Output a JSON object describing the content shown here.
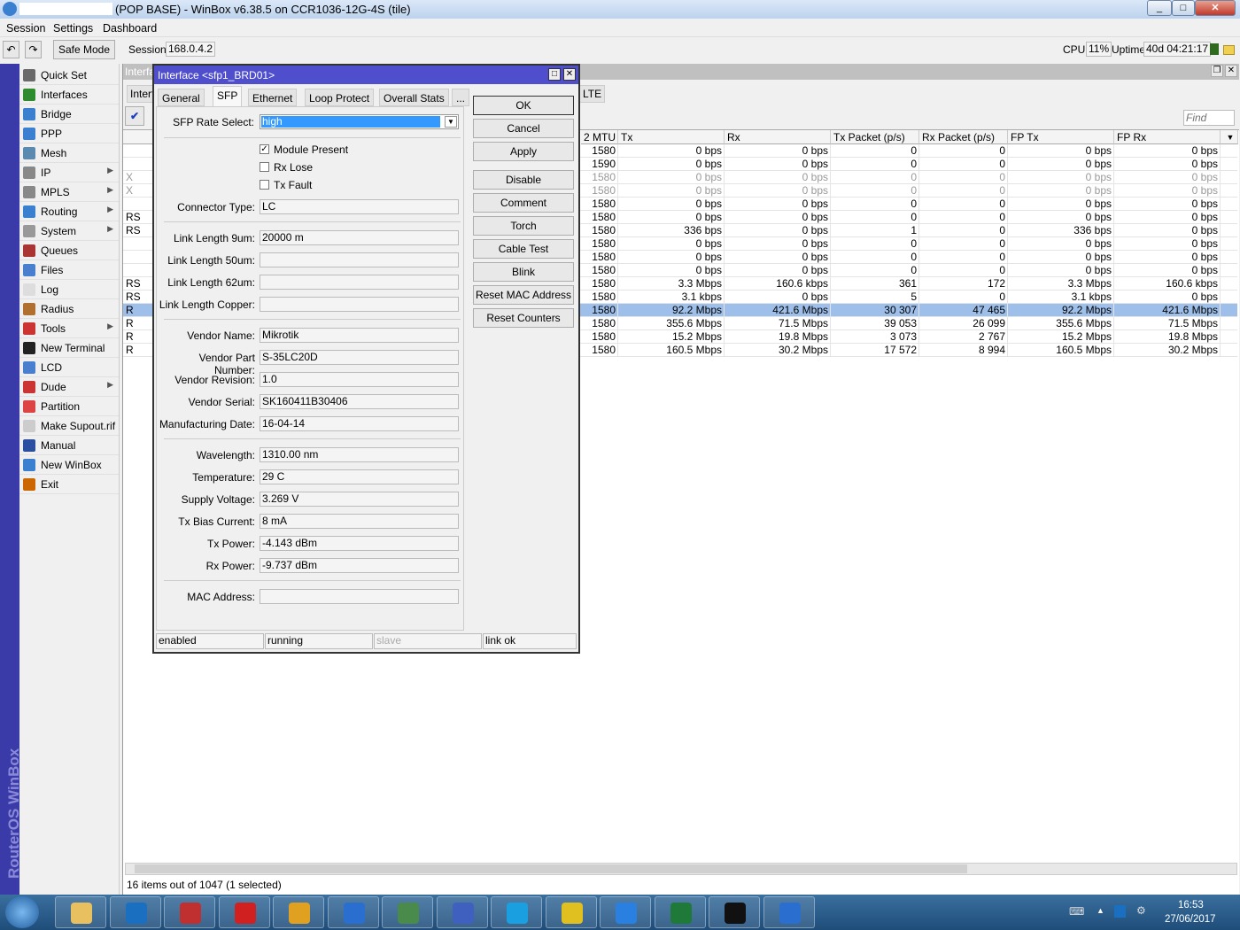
{
  "window": {
    "title": "(POP BASE) - WinBox v6.38.5 on CCR1036-12G-4S (tile)"
  },
  "menu": [
    "Session",
    "Settings",
    "Dashboard"
  ],
  "toolbar": {
    "safe_mode": "Safe Mode",
    "session_label": "Session:",
    "session_value": "168.0.4.2",
    "cpu_label": "CPU:",
    "cpu_value": "11%",
    "uptime_label": "Uptime:",
    "uptime_value": "40d 04:21:17"
  },
  "brand_vertical": "RouterOS WinBox",
  "sidebar": {
    "items": [
      {
        "label": "Quick Set",
        "icon": "wand-icon",
        "color": "#6a6a6a",
        "sub": false
      },
      {
        "label": "Interfaces",
        "icon": "interfaces-icon",
        "color": "#2e8b2e",
        "sub": false
      },
      {
        "label": "Bridge",
        "icon": "bridge-icon",
        "color": "#3a7fd0",
        "sub": false
      },
      {
        "label": "PPP",
        "icon": "ppp-icon",
        "color": "#3a7fd0",
        "sub": false
      },
      {
        "label": "Mesh",
        "icon": "mesh-icon",
        "color": "#5a8ab0",
        "sub": false
      },
      {
        "label": "IP",
        "icon": "ip-icon",
        "color": "#888",
        "sub": true
      },
      {
        "label": "MPLS",
        "icon": "mpls-icon",
        "color": "#888",
        "sub": true
      },
      {
        "label": "Routing",
        "icon": "routing-icon",
        "color": "#3a7fd0",
        "sub": true
      },
      {
        "label": "System",
        "icon": "gear-icon",
        "color": "#999",
        "sub": true
      },
      {
        "label": "Queues",
        "icon": "queues-icon",
        "color": "#a33",
        "sub": false
      },
      {
        "label": "Files",
        "icon": "folder-icon",
        "color": "#4a7fd0",
        "sub": false
      },
      {
        "label": "Log",
        "icon": "log-icon",
        "color": "#ddd",
        "sub": false
      },
      {
        "label": "Radius",
        "icon": "users-icon",
        "color": "#b07030",
        "sub": false
      },
      {
        "label": "Tools",
        "icon": "tools-icon",
        "color": "#c33",
        "sub": true
      },
      {
        "label": "New Terminal",
        "icon": "terminal-icon",
        "color": "#222",
        "sub": false
      },
      {
        "label": "LCD",
        "icon": "lcd-icon",
        "color": "#4a7fd0",
        "sub": false
      },
      {
        "label": "Dude",
        "icon": "dude-icon",
        "color": "#c33",
        "sub": true
      },
      {
        "label": "Partition",
        "icon": "partition-icon",
        "color": "#d44",
        "sub": false
      },
      {
        "label": "Make Supout.rif",
        "icon": "document-icon",
        "color": "#ccc",
        "sub": false
      },
      {
        "label": "Manual",
        "icon": "help-icon",
        "color": "#2a4fa0",
        "sub": false
      },
      {
        "label": "New WinBox",
        "icon": "winbox-icon",
        "color": "#3a7fd0",
        "sub": false
      },
      {
        "label": "Exit",
        "icon": "exit-icon",
        "color": "#c60",
        "sub": false
      }
    ]
  },
  "interface_window": {
    "title_fragment": "Interfa",
    "tab_fragment": "Interfa",
    "tab_lte": "LTE",
    "find_placeholder": "Find",
    "status": "16 items out of 1047 (1 selected)",
    "columns": [
      "2 MTU",
      "Tx",
      "Rx",
      "Tx Packet (p/s)",
      "Rx Packet (p/s)",
      "FP Tx",
      "FP Rx"
    ],
    "rows": [
      {
        "flag": "",
        "mtu": "1580",
        "tx": "0 bps",
        "rx": "0 bps",
        "txp": "0",
        "rxp": "0",
        "fptx": "0 bps",
        "fprx": "0 bps"
      },
      {
        "flag": "",
        "mtu": "1590",
        "tx": "0 bps",
        "rx": "0 bps",
        "txp": "0",
        "rxp": "0",
        "fptx": "0 bps",
        "fprx": "0 bps"
      },
      {
        "flag": "X",
        "mtu": "1580",
        "tx": "0 bps",
        "rx": "0 bps",
        "txp": "0",
        "rxp": "0",
        "fptx": "0 bps",
        "fprx": "0 bps",
        "disabled": true
      },
      {
        "flag": "X",
        "mtu": "1580",
        "tx": "0 bps",
        "rx": "0 bps",
        "txp": "0",
        "rxp": "0",
        "fptx": "0 bps",
        "fprx": "0 bps",
        "disabled": true
      },
      {
        "flag": "",
        "mtu": "1580",
        "tx": "0 bps",
        "rx": "0 bps",
        "txp": "0",
        "rxp": "0",
        "fptx": "0 bps",
        "fprx": "0 bps"
      },
      {
        "flag": "RS",
        "mtu": "1580",
        "tx": "0 bps",
        "rx": "0 bps",
        "txp": "0",
        "rxp": "0",
        "fptx": "0 bps",
        "fprx": "0 bps"
      },
      {
        "flag": "RS",
        "mtu": "1580",
        "tx": "336 bps",
        "rx": "0 bps",
        "txp": "1",
        "rxp": "0",
        "fptx": "336 bps",
        "fprx": "0 bps"
      },
      {
        "flag": "",
        "mtu": "1580",
        "tx": "0 bps",
        "rx": "0 bps",
        "txp": "0",
        "rxp": "0",
        "fptx": "0 bps",
        "fprx": "0 bps"
      },
      {
        "flag": "",
        "mtu": "1580",
        "tx": "0 bps",
        "rx": "0 bps",
        "txp": "0",
        "rxp": "0",
        "fptx": "0 bps",
        "fprx": "0 bps"
      },
      {
        "flag": "",
        "mtu": "1580",
        "tx": "0 bps",
        "rx": "0 bps",
        "txp": "0",
        "rxp": "0",
        "fptx": "0 bps",
        "fprx": "0 bps"
      },
      {
        "flag": "RS",
        "mtu": "1580",
        "tx": "3.3 Mbps",
        "rx": "160.6 kbps",
        "txp": "361",
        "rxp": "172",
        "fptx": "3.3 Mbps",
        "fprx": "160.6 kbps"
      },
      {
        "flag": "RS",
        "mtu": "1580",
        "tx": "3.1 kbps",
        "rx": "0 bps",
        "txp": "5",
        "rxp": "0",
        "fptx": "3.1 kbps",
        "fprx": "0 bps"
      },
      {
        "flag": "R",
        "mtu": "1580",
        "tx": "92.2 Mbps",
        "rx": "421.6 Mbps",
        "txp": "30 307",
        "rxp": "47 465",
        "fptx": "92.2 Mbps",
        "fprx": "421.6 Mbps",
        "selected": true
      },
      {
        "flag": "R",
        "mtu": "1580",
        "tx": "355.6 Mbps",
        "rx": "71.5 Mbps",
        "txp": "39 053",
        "rxp": "26 099",
        "fptx": "355.6 Mbps",
        "fprx": "71.5 Mbps"
      },
      {
        "flag": "R",
        "mtu": "1580",
        "tx": "15.2 Mbps",
        "rx": "19.8 Mbps",
        "txp": "3 073",
        "rxp": "2 767",
        "fptx": "15.2 Mbps",
        "fprx": "19.8 Mbps"
      },
      {
        "flag": "R",
        "mtu": "1580",
        "tx": "160.5 Mbps",
        "rx": "30.2 Mbps",
        "txp": "17 572",
        "rxp": "8 994",
        "fptx": "160.5 Mbps",
        "fprx": "30.2 Mbps"
      }
    ]
  },
  "dialog": {
    "title": "Interface <sfp1_BRD01>",
    "tabs": [
      "General",
      "SFP",
      "Ethernet",
      "Loop Protect",
      "Overall Stats",
      "..."
    ],
    "sfp_rate_label": "SFP Rate Select:",
    "sfp_rate_value": "high",
    "module_present": "Module Present",
    "rx_lose": "Rx Lose",
    "tx_fault": "Tx Fault",
    "fields": [
      {
        "label": "Connector Type:",
        "value": "LC"
      },
      {
        "label": "Link Length 9um:",
        "value": "20000 m"
      },
      {
        "label": "Link Length 50um:",
        "value": ""
      },
      {
        "label": "Link Length 62um:",
        "value": ""
      },
      {
        "label": "Link Length Copper:",
        "value": ""
      },
      {
        "label": "Vendor Name:",
        "value": "Mikrotik"
      },
      {
        "label": "Vendor Part Number:",
        "value": "S-35LC20D"
      },
      {
        "label": "Vendor Revision:",
        "value": "1.0"
      },
      {
        "label": "Vendor Serial:",
        "value": "SK160411B30406"
      },
      {
        "label": "Manufacturing Date:",
        "value": "16-04-14"
      },
      {
        "label": "Wavelength:",
        "value": "1310.00 nm"
      },
      {
        "label": "Temperature:",
        "value": "29 C"
      },
      {
        "label": "Supply Voltage:",
        "value": "3.269 V"
      },
      {
        "label": "Tx Bias Current:",
        "value": "8 mA"
      },
      {
        "label": "Tx Power:",
        "value": "-4.143 dBm"
      },
      {
        "label": "Rx Power:",
        "value": "-9.737 dBm"
      },
      {
        "label": "MAC Address:",
        "value": ""
      }
    ],
    "buttons": [
      "OK",
      "Cancel",
      "Apply",
      "Disable",
      "Comment",
      "Torch",
      "Cable Test",
      "Blink",
      "Reset MAC Address",
      "Reset Counters"
    ],
    "status": [
      "enabled",
      "running",
      "slave",
      "link ok"
    ]
  },
  "taskbar": {
    "apps": [
      "explorer-icon",
      "outlook-icon",
      "acrobat-icon",
      "app-red-icon",
      "chrome-icon",
      "winbox-icon",
      "vpn-icon",
      "network-icon",
      "skype-icon",
      "xmind-icon",
      "ie-icon",
      "excel-icon",
      "cmd-icon",
      "winbox-icon"
    ],
    "clock_time": "16:53",
    "clock_date": "27/06/2017"
  }
}
